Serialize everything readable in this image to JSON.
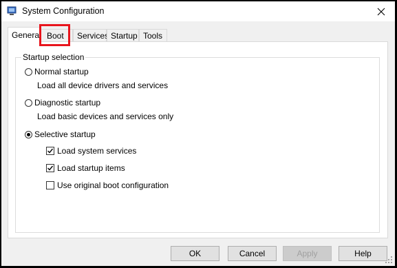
{
  "window": {
    "title": "System Configuration"
  },
  "tabs": [
    {
      "label": "General",
      "active": true
    },
    {
      "label": "Boot",
      "active": false
    },
    {
      "label": "Services",
      "active": false
    },
    {
      "label": "Startup",
      "active": false
    },
    {
      "label": "Tools",
      "active": false
    }
  ],
  "startup_selection": {
    "legend": "Startup selection",
    "normal": {
      "label": "Normal startup",
      "description": "Load all device drivers and services",
      "selected": false
    },
    "diagnostic": {
      "label": "Diagnostic startup",
      "description": "Load basic devices and services only",
      "selected": false
    },
    "selective": {
      "label": "Selective startup",
      "selected": true
    },
    "options": [
      {
        "label": "Load system services",
        "checked": true
      },
      {
        "label": "Load startup items",
        "checked": true
      },
      {
        "label": "Use original boot configuration",
        "checked": false
      }
    ]
  },
  "buttons": {
    "ok": "OK",
    "cancel": "Cancel",
    "apply": "Apply",
    "help": "Help"
  },
  "colors": {
    "highlight": "#e8141c",
    "window_bg": "#f0f0f0",
    "panel_bg": "#ffffff"
  }
}
